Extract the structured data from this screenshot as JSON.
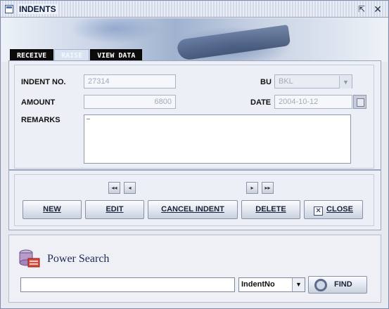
{
  "window": {
    "title": "INDENTS",
    "minimize_glyph": "⇱",
    "close_glyph": "✕"
  },
  "tabs": [
    {
      "label": "RECEIVE",
      "active": false
    },
    {
      "label": "RAISE",
      "active": true
    },
    {
      "label": "VIEW DATA",
      "active": false
    }
  ],
  "form": {
    "indent_no_label": "INDENT NO.",
    "indent_no_value": "27314",
    "amount_label": "AMOUNT",
    "amount_value": "6800",
    "remarks_label": "REMARKS",
    "remarks_value": "",
    "bu_label": "BU",
    "bu_value": "BKL",
    "date_label": "DATE",
    "date_value": "2004-10-12"
  },
  "navigation": {
    "first_icon": "first-record-icon",
    "prev_icon": "previous-record-icon",
    "next_icon": "next-record-icon",
    "last_icon": "last-record-icon",
    "first_glyph": "◂◂",
    "prev_glyph": "◂",
    "next_glyph": "▸",
    "last_glyph": "▸▸"
  },
  "actions": {
    "new_label": "NEW",
    "edit_label": "EDIT",
    "cancel_label": "CANCEL INDENT",
    "delete_label": "DELETE",
    "close_label": "CLOSE",
    "close_glyph": "✕"
  },
  "power_search": {
    "title": "Power Search",
    "query": "",
    "field_selected": "IndentNo",
    "find_label": "FIND",
    "dropdown_glyph": "▼"
  },
  "colors": {
    "active_tab": "#d8e3f2",
    "inactive_tab": "#0b0b0b",
    "panel_border": "#9aa6bf"
  }
}
